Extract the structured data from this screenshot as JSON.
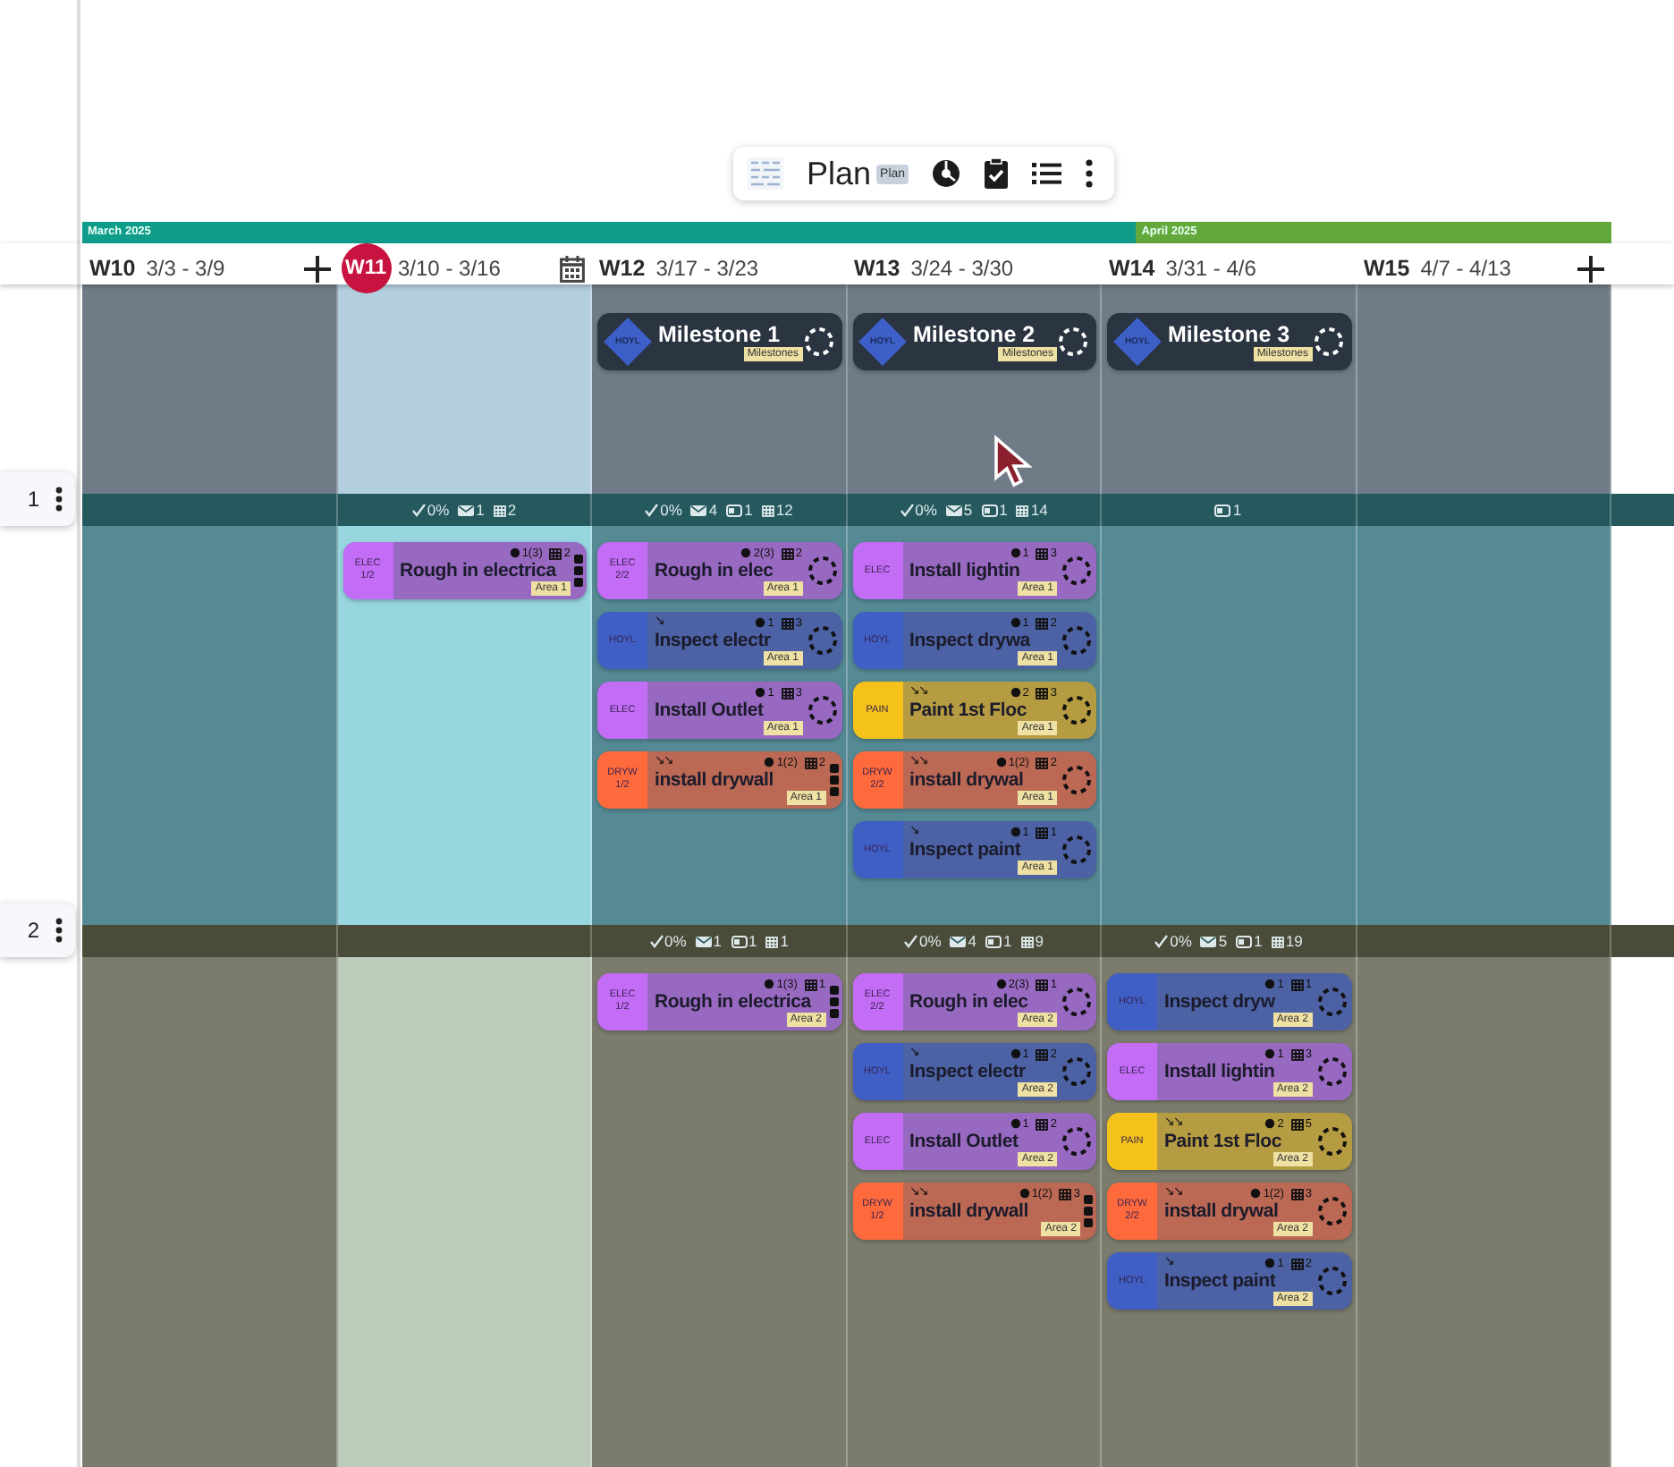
{
  "toolbar": {
    "title": "Plan",
    "badge": "Plan"
  },
  "months": [
    {
      "label": "March 2025",
      "color": "#109c8b"
    },
    {
      "label": "April 2025",
      "color": "#62a83a"
    }
  ],
  "weeks": [
    {
      "week": "W10",
      "dates": "3/3 - 3/9",
      "current": false,
      "add_button": true,
      "calendar_button": false
    },
    {
      "week": "W11",
      "dates": "3/10 - 3/16",
      "current": true,
      "add_button": false,
      "calendar_button": true
    },
    {
      "week": "W12",
      "dates": "3/17 - 3/23",
      "current": false,
      "add_button": false,
      "calendar_button": false
    },
    {
      "week": "W13",
      "dates": "3/24 - 3/30",
      "current": false,
      "add_button": false,
      "calendar_button": false
    },
    {
      "week": "W14",
      "dates": "3/31 - 4/6",
      "current": false,
      "add_button": false,
      "calendar_button": false
    },
    {
      "week": "W15",
      "dates": "4/7 - 4/13",
      "current": false,
      "add_button": true,
      "calendar_button": false
    }
  ],
  "milestone_lane": {
    "cells": [
      {},
      {},
      {
        "cards": [
          {
            "icon_label": "HOYL",
            "title": "Milestone 1",
            "tag": "Milestones",
            "ring": true
          }
        ]
      },
      {
        "cards": [
          {
            "icon_label": "HOYL",
            "title": "Milestone 2",
            "tag": "Milestones",
            "ring": true
          }
        ]
      },
      {
        "cards": [
          {
            "icon_label": "HOYL",
            "title": "Milestone 3",
            "tag": "Milestones",
            "ring": true
          }
        ]
      },
      {}
    ]
  },
  "lanes": [
    {
      "handle": "1",
      "cells": [
        {},
        {
          "summary": [
            {
              "kind": "check",
              "text": "0%"
            },
            {
              "kind": "mail",
              "text": "1"
            },
            {
              "kind": "grid",
              "text": "2"
            }
          ],
          "cards": [
            {
              "badge": "ELEC",
              "part": "1/2",
              "color": "#c36cf6",
              "meta": [
                {
                  "kind": "dot",
                  "text": "1(3)"
                },
                {
                  "kind": "grid",
                  "text": "2"
                }
              ],
              "title": "Rough in electrica",
              "tag": "Area 1",
              "ring": false,
              "handle": true
            }
          ]
        },
        {
          "summary": [
            {
              "kind": "check",
              "text": "0%"
            },
            {
              "kind": "mail",
              "text": "4"
            },
            {
              "kind": "card",
              "text": "1"
            },
            {
              "kind": "grid",
              "text": "12"
            }
          ],
          "cards": [
            {
              "badge": "ELEC",
              "part": "2/2",
              "color": "#c36cf6",
              "meta": [
                {
                  "kind": "dot",
                  "text": "2(3)"
                },
                {
                  "kind": "grid",
                  "text": "2"
                }
              ],
              "title": "Rough in elec",
              "tag": "Area 1",
              "ring": true,
              "handle": false
            },
            {
              "badge": "HOYL",
              "color": "#3f5fc5",
              "links": "↘",
              "meta": [
                {
                  "kind": "dot",
                  "text": "1"
                },
                {
                  "kind": "grid",
                  "text": "3"
                }
              ],
              "title": "Inspect electr",
              "tag": "Area 1",
              "ring": true,
              "handle": false
            },
            {
              "badge": "ELEC",
              "color": "#c36cf6",
              "meta": [
                {
                  "kind": "dot",
                  "text": "1"
                },
                {
                  "kind": "grid",
                  "text": "3"
                }
              ],
              "title": "Install Outlet",
              "tag": "Area 1",
              "ring": true,
              "handle": false
            },
            {
              "badge": "DRYW",
              "part": "1/2",
              "color": "#ff6a3d",
              "links": "↘↘",
              "meta": [
                {
                  "kind": "dot",
                  "text": "1(2)"
                },
                {
                  "kind": "grid",
                  "text": "2"
                }
              ],
              "title": "install drywall",
              "tag": "Area 1",
              "ring": false,
              "handle": true
            }
          ]
        },
        {
          "summary": [
            {
              "kind": "check",
              "text": "0%"
            },
            {
              "kind": "mail",
              "text": "5"
            },
            {
              "kind": "card",
              "text": "1"
            },
            {
              "kind": "grid",
              "text": "14"
            }
          ],
          "cards": [
            {
              "badge": "ELEC",
              "color": "#c36cf6",
              "meta": [
                {
                  "kind": "dot",
                  "text": "1"
                },
                {
                  "kind": "grid",
                  "text": "3"
                }
              ],
              "title": "Install lightin",
              "tag": "Area 1",
              "ring": true,
              "handle": false
            },
            {
              "badge": "HOYL",
              "color": "#3f5fc5",
              "meta": [
                {
                  "kind": "dot",
                  "text": "1"
                },
                {
                  "kind": "grid",
                  "text": "2"
                }
              ],
              "title": "Inspect drywa",
              "tag": "Area 1",
              "ring": true,
              "handle": false
            },
            {
              "badge": "PAIN",
              "color": "#f4c21a",
              "links": "↘↘",
              "meta": [
                {
                  "kind": "dot",
                  "text": "2"
                },
                {
                  "kind": "grid",
                  "text": "3"
                }
              ],
              "title": "Paint 1st Floc",
              "tag": "Area 1",
              "ring": true,
              "handle": false
            },
            {
              "badge": "DRYW",
              "part": "2/2",
              "color": "#ff6a3d",
              "links": "↘↘",
              "meta": [
                {
                  "kind": "dot",
                  "text": "1(2)"
                },
                {
                  "kind": "grid",
                  "text": "2"
                }
              ],
              "title": "install drywal",
              "tag": "Area 1",
              "ring": true,
              "handle": false
            },
            {
              "badge": "HOYL",
              "color": "#3f5fc5",
              "links": "↘",
              "meta": [
                {
                  "kind": "dot",
                  "text": "1"
                },
                {
                  "kind": "grid",
                  "text": "1"
                }
              ],
              "title": "Inspect paint",
              "tag": "Area 1",
              "ring": true,
              "handle": false
            }
          ]
        },
        {
          "summary": [
            {
              "kind": "card",
              "text": "1"
            }
          ]
        },
        {}
      ]
    },
    {
      "handle": "2",
      "cells": [
        {},
        {},
        {
          "summary": [
            {
              "kind": "check",
              "text": "0%"
            },
            {
              "kind": "mail",
              "text": "1"
            },
            {
              "kind": "card",
              "text": "1"
            },
            {
              "kind": "grid",
              "text": "1"
            }
          ],
          "cards": [
            {
              "badge": "ELEC",
              "part": "1/2",
              "color": "#c36cf6",
              "meta": [
                {
                  "kind": "dot",
                  "text": "1(3)"
                },
                {
                  "kind": "grid",
                  "text": "1"
                }
              ],
              "title": "Rough in electrica",
              "tag": "Area 2",
              "ring": false,
              "handle": true
            }
          ]
        },
        {
          "summary": [
            {
              "kind": "check",
              "text": "0%"
            },
            {
              "kind": "mail",
              "text": "4"
            },
            {
              "kind": "card",
              "text": "1"
            },
            {
              "kind": "grid",
              "text": "9"
            }
          ],
          "cards": [
            {
              "badge": "ELEC",
              "part": "2/2",
              "color": "#c36cf6",
              "meta": [
                {
                  "kind": "dot",
                  "text": "2(3)"
                },
                {
                  "kind": "grid",
                  "text": "1"
                }
              ],
              "title": "Rough in elec",
              "tag": "Area 2",
              "ring": true,
              "handle": false
            },
            {
              "badge": "HOYL",
              "color": "#3f5fc5",
              "links": "↘",
              "meta": [
                {
                  "kind": "dot",
                  "text": "1"
                },
                {
                  "kind": "grid",
                  "text": "2"
                }
              ],
              "title": "Inspect electr",
              "tag": "Area 2",
              "ring": true,
              "handle": false
            },
            {
              "badge": "ELEC",
              "color": "#c36cf6",
              "meta": [
                {
                  "kind": "dot",
                  "text": "1"
                },
                {
                  "kind": "grid",
                  "text": "2"
                }
              ],
              "title": "Install Outlet",
              "tag": "Area 2",
              "ring": true,
              "handle": false
            },
            {
              "badge": "DRYW",
              "part": "1/2",
              "color": "#ff6a3d",
              "links": "↘↘",
              "meta": [
                {
                  "kind": "dot",
                  "text": "1(2)"
                },
                {
                  "kind": "grid",
                  "text": "3"
                }
              ],
              "title": "install drywall",
              "tag": "Area 2",
              "ring": false,
              "handle": true
            }
          ]
        },
        {
          "summary": [
            {
              "kind": "check",
              "text": "0%"
            },
            {
              "kind": "mail",
              "text": "5"
            },
            {
              "kind": "card",
              "text": "1"
            },
            {
              "kind": "grid",
              "text": "19"
            }
          ],
          "cards": [
            {
              "badge": "HOYL",
              "color": "#3f5fc5",
              "meta": [
                {
                  "kind": "dot",
                  "text": "1"
                },
                {
                  "kind": "grid",
                  "text": "1"
                }
              ],
              "title": "Inspect dryw",
              "tag": "Area 2",
              "ring": true,
              "handle": false
            },
            {
              "badge": "ELEC",
              "color": "#c36cf6",
              "meta": [
                {
                  "kind": "dot",
                  "text": "1"
                },
                {
                  "kind": "grid",
                  "text": "3"
                }
              ],
              "title": "Install lightin",
              "tag": "Area 2",
              "ring": true,
              "handle": false
            },
            {
              "badge": "PAIN",
              "color": "#f4c21a",
              "links": "↘↘",
              "meta": [
                {
                  "kind": "dot",
                  "text": "2"
                },
                {
                  "kind": "grid",
                  "text": "5"
                }
              ],
              "title": "Paint 1st Floc",
              "tag": "Area 2",
              "ring": true,
              "handle": false
            },
            {
              "badge": "DRYW",
              "part": "2/2",
              "color": "#ff6a3d",
              "links": "↘↘",
              "meta": [
                {
                  "kind": "dot",
                  "text": "1(2)"
                },
                {
                  "kind": "grid",
                  "text": "3"
                }
              ],
              "title": "install drywal",
              "tag": "Area 2",
              "ring": true,
              "handle": false
            },
            {
              "badge": "HOYL",
              "color": "#3f5fc5",
              "links": "↘",
              "meta": [
                {
                  "kind": "dot",
                  "text": "1"
                },
                {
                  "kind": "grid",
                  "text": "2"
                }
              ],
              "title": "Inspect paint",
              "tag": "Area 2",
              "ring": true,
              "handle": false
            }
          ]
        },
        {}
      ]
    }
  ]
}
